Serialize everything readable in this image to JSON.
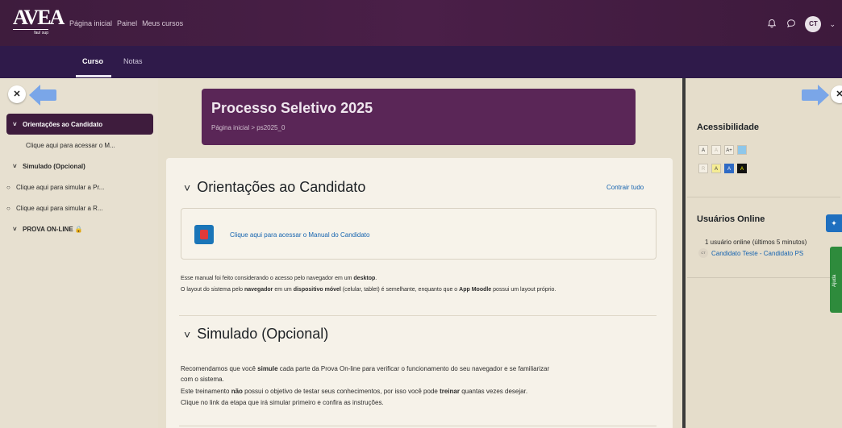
{
  "logo": {
    "text": "AVEA",
    "subtext": "fau! sup"
  },
  "topnav": {
    "items": [
      "Página inicial",
      "Painel",
      "Meus cursos"
    ]
  },
  "user": {
    "initials": "CT"
  },
  "secnav": {
    "tabs": [
      "Curso",
      "Notas"
    ],
    "active": "Curso"
  },
  "icons": {
    "bell": "bell-icon",
    "chat": "chat-icon",
    "close": "close-icon",
    "arrow_left": "arrow-left-icon",
    "arrow_right": "arrow-right-icon"
  },
  "course_index": {
    "items": [
      {
        "label": "Orientações ao Candidato",
        "type": "section",
        "lead": "˅",
        "active": true
      },
      {
        "label": "Clique aqui para acessar o M...",
        "type": "activity",
        "lead": ""
      },
      {
        "label": "Simulado (Opcional)",
        "type": "section",
        "lead": "˅"
      },
      {
        "label": "Clique aqui para simular a Pr...",
        "type": "activity",
        "lead": "○"
      },
      {
        "label": "Clique aqui para simular a R...",
        "type": "activity",
        "lead": "○"
      },
      {
        "label": "PROVA ON-LINE 🔒",
        "type": "section",
        "lead": "˅"
      }
    ]
  },
  "header": {
    "title": "Processo Seletivo 2025",
    "breadcrumb": "Página inicial  >  ps2025_0"
  },
  "section1": {
    "title": "Orientações ao Candidato",
    "collapse_label": "Contrair tudo",
    "activity_label": "Clique aqui para acessar o Manual do Candidato",
    "paragraph1": [
      "Esse manual foi feito considerando o acesso pelo navegador em um ",
      "desktop",
      "."
    ],
    "paragraph2": [
      "O layout do sistema pelo ",
      "navegador",
      " em um ",
      "dispositivo móvel",
      " (celular, tablet) é semelhante, enquanto que o ",
      "App Moodle",
      " possui um layout próprio."
    ]
  },
  "section2": {
    "title": "Simulado (Opcional)",
    "line1": [
      "Recomendamos que você ",
      "simule",
      " cada parte da Prova On-line para verificar o funcionamento do seu navegador e se familiarizar"
    ],
    "line2": "com o sistema.",
    "line3": [
      "Este treinamento ",
      "não",
      " possui o objetivo de testar seus conhecimentos, por isso você pode ",
      "treinar",
      " quantas vezes desejar."
    ],
    "line4": "Clique no link da etapa que irá simular primeiro e confira as instruções."
  },
  "right_drawer": {
    "accessibility_title": "Acessibilidade",
    "font_buttons": [
      "A",
      "A",
      "A+"
    ],
    "contrast_buttons": [
      "R",
      "A",
      "A",
      "A"
    ],
    "online_title": "Usuários Online",
    "online_count": "1 usuário online (últimos 5 minutos)",
    "online_user_initials": "CT",
    "online_user_name": "Candidato Teste - Candidato PS",
    "side_tab_label": "Ajuda"
  }
}
